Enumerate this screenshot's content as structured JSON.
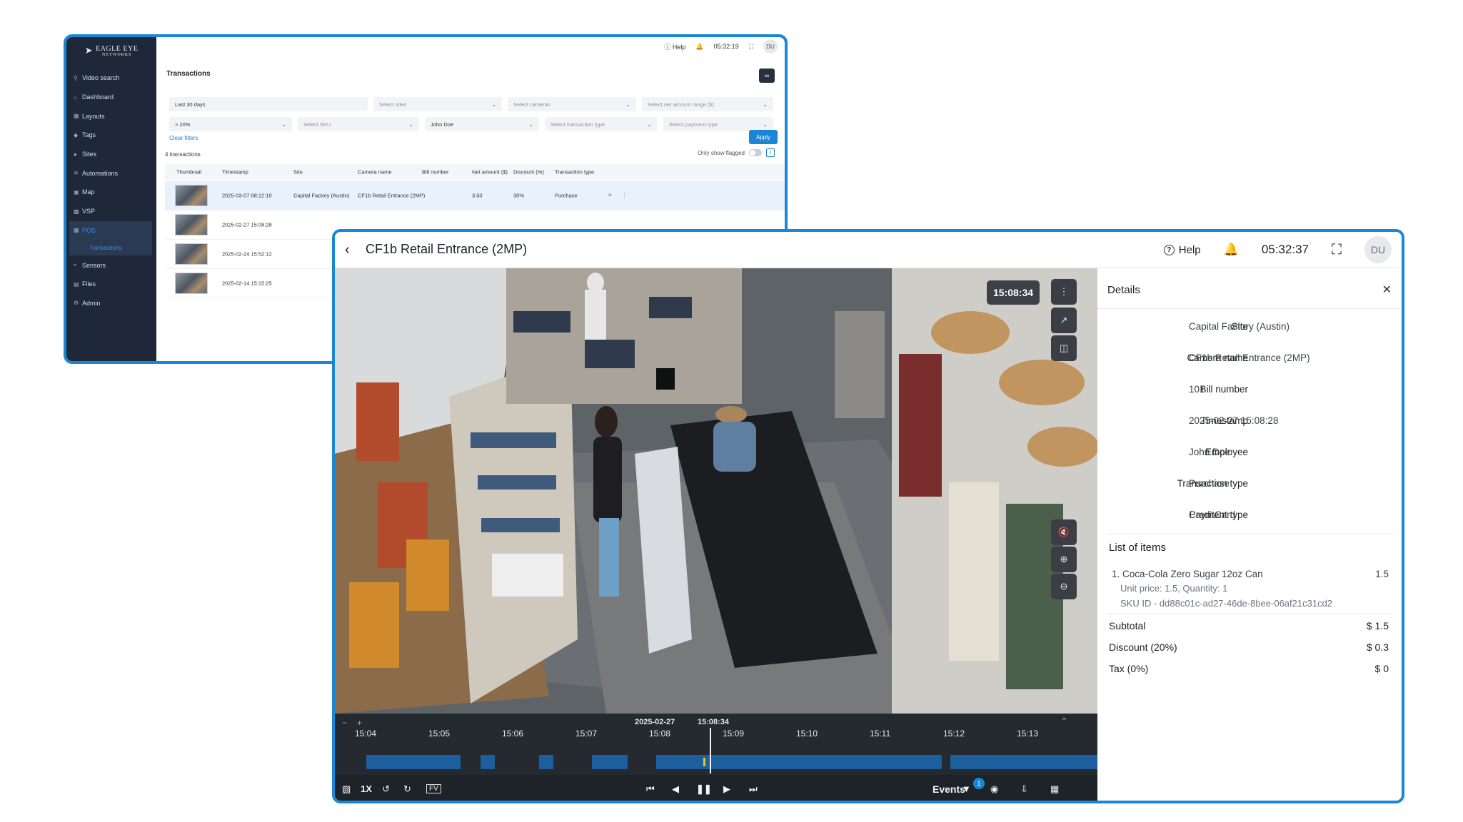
{
  "app": {
    "logo_line1": "EAGLE EYE",
    "logo_line2": "NETWORKS"
  },
  "transactions_window": {
    "topbar": {
      "help": "Help",
      "time": "05:32:19",
      "avatar": "DU"
    },
    "sidebar": [
      {
        "label": "Video search",
        "icon": "search-icon"
      },
      {
        "label": "Dashboard",
        "icon": "dashboard-icon"
      },
      {
        "label": "Layouts",
        "icon": "layouts-icon"
      },
      {
        "label": "Tags",
        "icon": "tag-icon"
      },
      {
        "label": "Sites",
        "icon": "location-icon"
      },
      {
        "label": "Automations",
        "icon": "automation-icon"
      },
      {
        "label": "Map",
        "icon": "map-icon"
      },
      {
        "label": "VSP",
        "icon": "car-icon"
      },
      {
        "label": "POS",
        "icon": "pos-icon"
      },
      {
        "label": "Sensors",
        "icon": "sensor-icon"
      },
      {
        "label": "Files",
        "icon": "files-icon"
      },
      {
        "label": "Admin",
        "icon": "admin-icon"
      }
    ],
    "sidebar_sub": "Transactions",
    "title": "Transactions",
    "filters": {
      "date": "Last 30 days",
      "sites": "Select sites",
      "cameras": "Select cameras",
      "net_amount": "Select net amount range ($)",
      "discount": "> 20%",
      "sku": "Select SKU",
      "employee": "John Doe",
      "transaction_type": "Select transaction type",
      "payment_type": "Select payment type"
    },
    "clear_filters": "Clear filters",
    "apply": "Apply",
    "count": "4 transactions",
    "only_flagged": "Only show flagged",
    "columns": [
      "Thumbnail",
      "Timestamp",
      "Site",
      "Camera name",
      "Bill number",
      "Net amount ($)",
      "Discount (%)",
      "Transaction type"
    ],
    "rows": [
      {
        "timestamp": "2025-03-07 08:12:10",
        "site": "Capital Factory (Austin)",
        "camera": "CF1b Retail Entrance (2MP)",
        "net_amount": "3.50",
        "discount": "30%",
        "type": "Purchase"
      },
      {
        "timestamp": "2025-02-27 15:08:28"
      },
      {
        "timestamp": "2025-02-24 15:52:12"
      },
      {
        "timestamp": "2025-02-14 15:15:25"
      }
    ]
  },
  "camera_window": {
    "title": "CF1b Retail Entrance (2MP)",
    "help": "Help",
    "time": "05:32:37",
    "avatar": "DU",
    "video_timestamp": "15:08:34",
    "timeline": {
      "date": "2025-02-27",
      "time": "15:08:34",
      "ticks": [
        "15:04",
        "15:05",
        "15:06",
        "15:07",
        "15:08",
        "15:09",
        "15:10",
        "15:11",
        "15:12",
        "15:13"
      ]
    },
    "controls": {
      "speed": "1X",
      "fv": "FV",
      "events": "Events",
      "events_count": "1"
    },
    "details": {
      "title": "Details",
      "fields": [
        {
          "label": "Site",
          "value": "Capital Factory (Austin)"
        },
        {
          "label": "Camera name",
          "value": "CF1b Retail Entrance (2MP)"
        },
        {
          "label": "Bill number",
          "value": "101"
        },
        {
          "label": "Timestamp",
          "value": "2025-02-27 15:08:28"
        },
        {
          "label": "Employee",
          "value": "John Doe"
        },
        {
          "label": "Transaction type",
          "value": "Purchase"
        },
        {
          "label": "Payment type",
          "value": "CreditCard"
        }
      ],
      "list_heading": "List of items",
      "item": {
        "name": "1. Coca-Cola Zero Sugar 12oz Can",
        "value": "1.5",
        "unit": "Unit price: 1.5, Quantity: 1",
        "sku": "SKU ID - dd88c01c-ad27-46de-8bee-06af21c31cd2"
      },
      "subtotal_label": "Subtotal",
      "subtotal": "$ 1.5",
      "discount_label": "Discount (20%)",
      "discount": "$ 0.3",
      "tax_label": "Tax (0%)",
      "tax": "$ 0"
    }
  },
  "colors": {
    "accent": "#1a87d6",
    "sidebar": "#1f2838",
    "timeline": "#252a30",
    "marker": "#f0c419"
  }
}
